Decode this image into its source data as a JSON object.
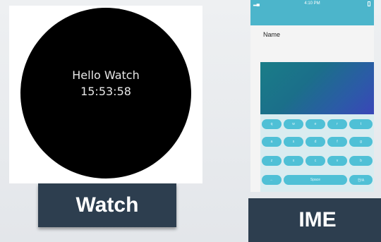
{
  "watch": {
    "hello": "Hello Watch",
    "time": "15:53:58",
    "label": "Watch"
  },
  "ime": {
    "label": "IME",
    "status_time": "4:10 PM",
    "field_label": "Name",
    "keys": {
      "row1": [
        "q",
        "w",
        "e",
        "r",
        "t"
      ],
      "row2": [
        "a",
        "s",
        "d",
        "f",
        "g"
      ],
      "row3": [
        "z",
        "x",
        "c",
        "v",
        "b"
      ],
      "back": "←",
      "space": "Space",
      "lang": "한/A"
    }
  },
  "colors": {
    "label_bg": "#2d3e4f",
    "accent": "#4cb5cb",
    "key": "#4fc0d6"
  }
}
